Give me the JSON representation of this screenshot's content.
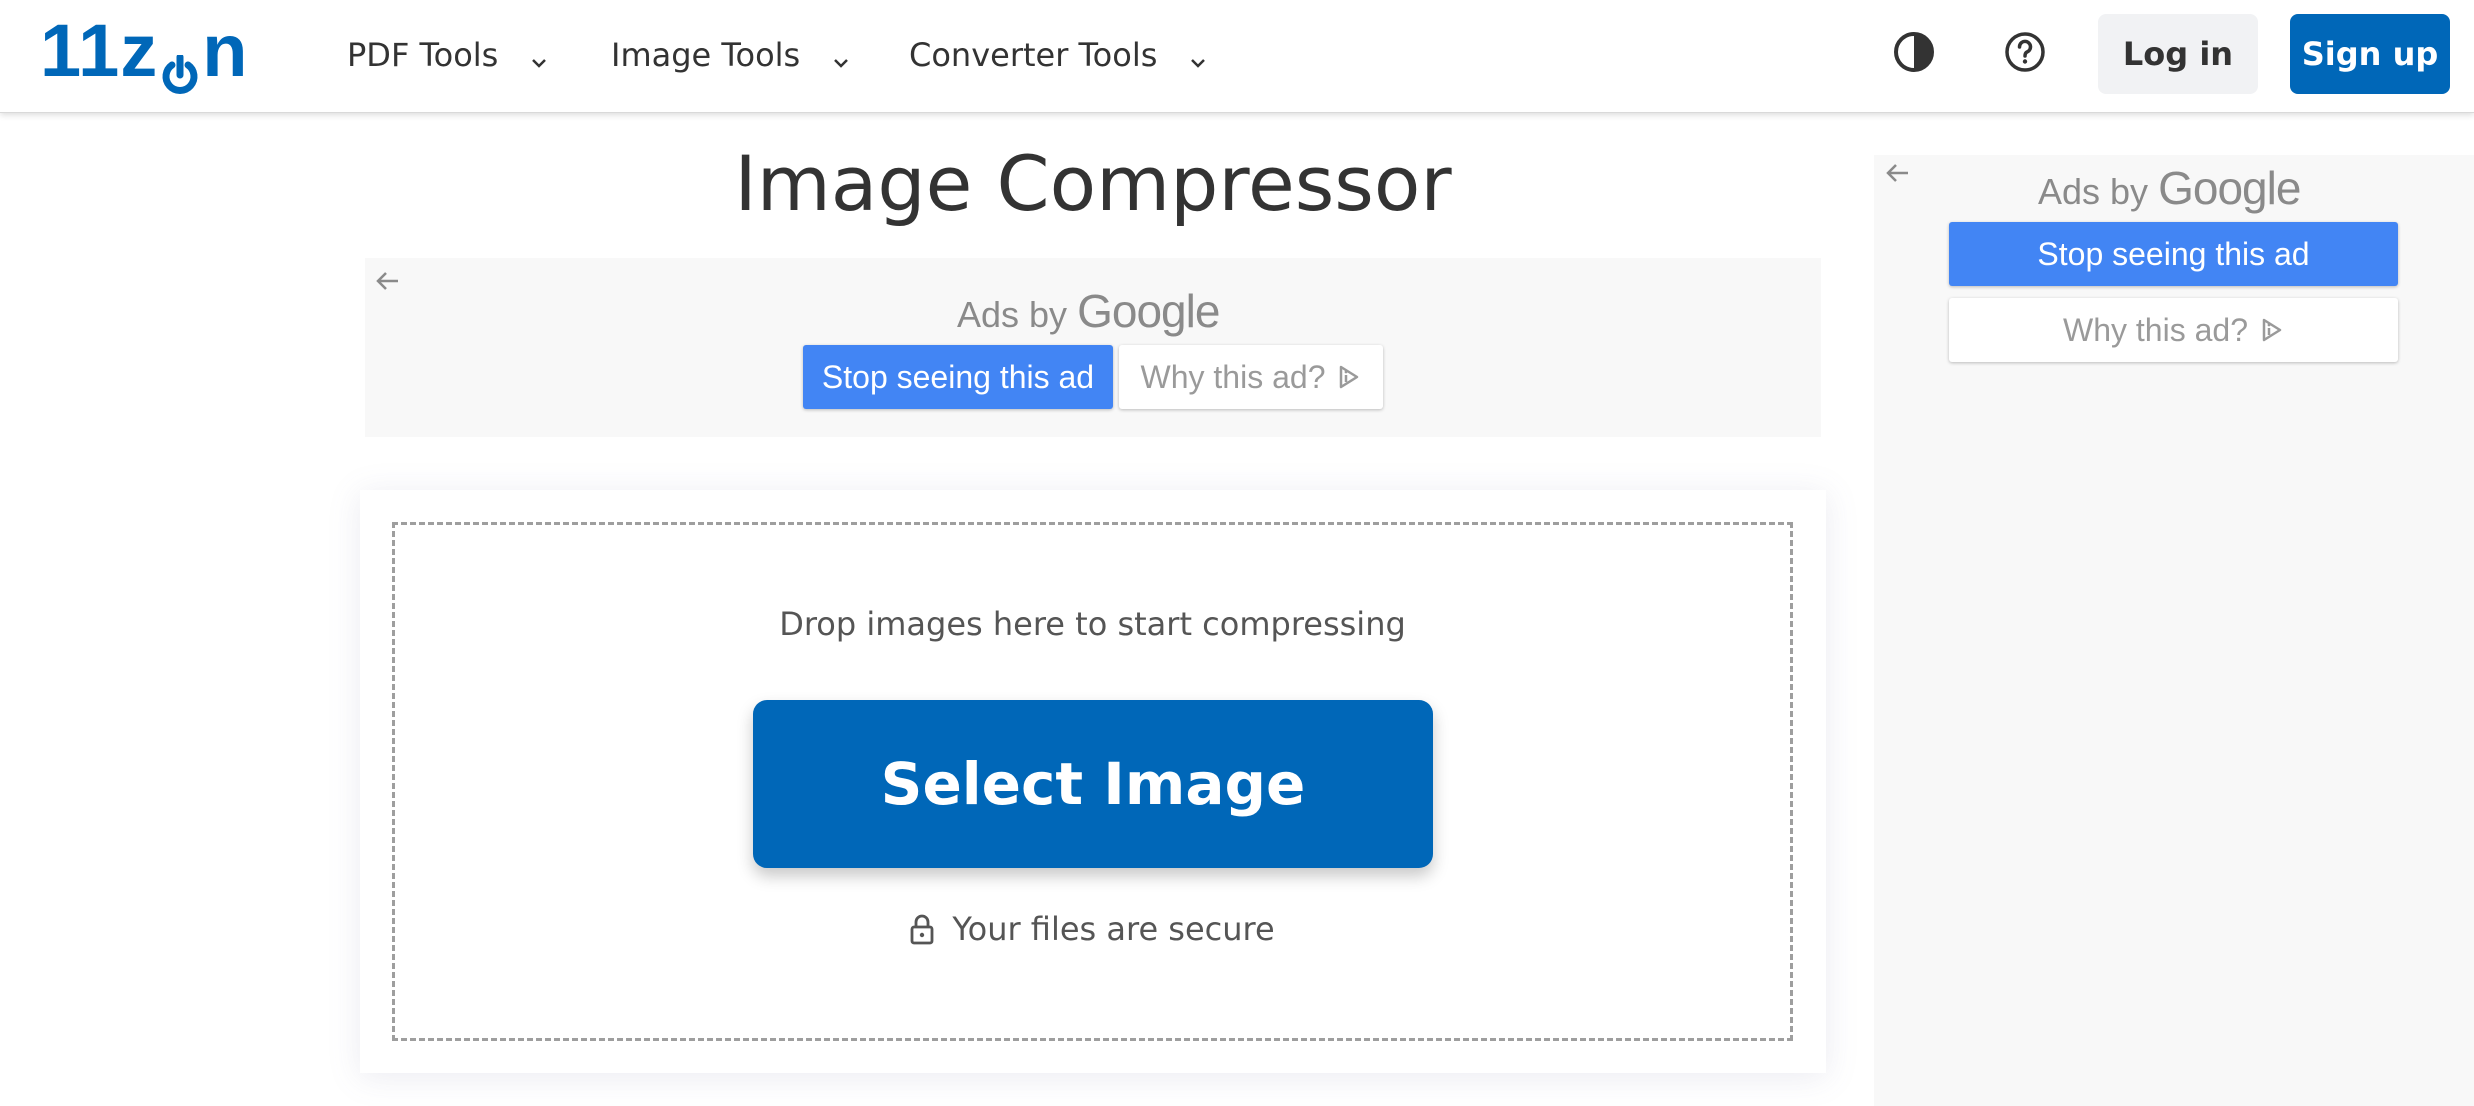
{
  "header": {
    "logo_text_left": "11z",
    "logo_text_right": "n",
    "nav": [
      {
        "label": "PDF Tools"
      },
      {
        "label": "Image Tools"
      },
      {
        "label": "Converter Tools"
      }
    ],
    "icons": {
      "theme": "contrast-icon",
      "help": "help-circle-icon"
    },
    "login_label": "Log in",
    "signup_label": "Sign up"
  },
  "colors": {
    "brand": "#0067b8",
    "ad_blue": "#4285f4"
  },
  "main": {
    "title": "Image Compressor",
    "drop_text": "Drop images here to start compressing",
    "select_button": "Select Image",
    "secure_text": "Your files are secure"
  },
  "ads": {
    "inline": {
      "ads_by": "Ads by",
      "google": "Google",
      "stop": "Stop seeing this ad",
      "why": "Why this ad?"
    },
    "sidebar": {
      "ads_by": "Ads by",
      "google": "Google",
      "stop": "Stop seeing this ad",
      "why": "Why this ad?"
    }
  }
}
